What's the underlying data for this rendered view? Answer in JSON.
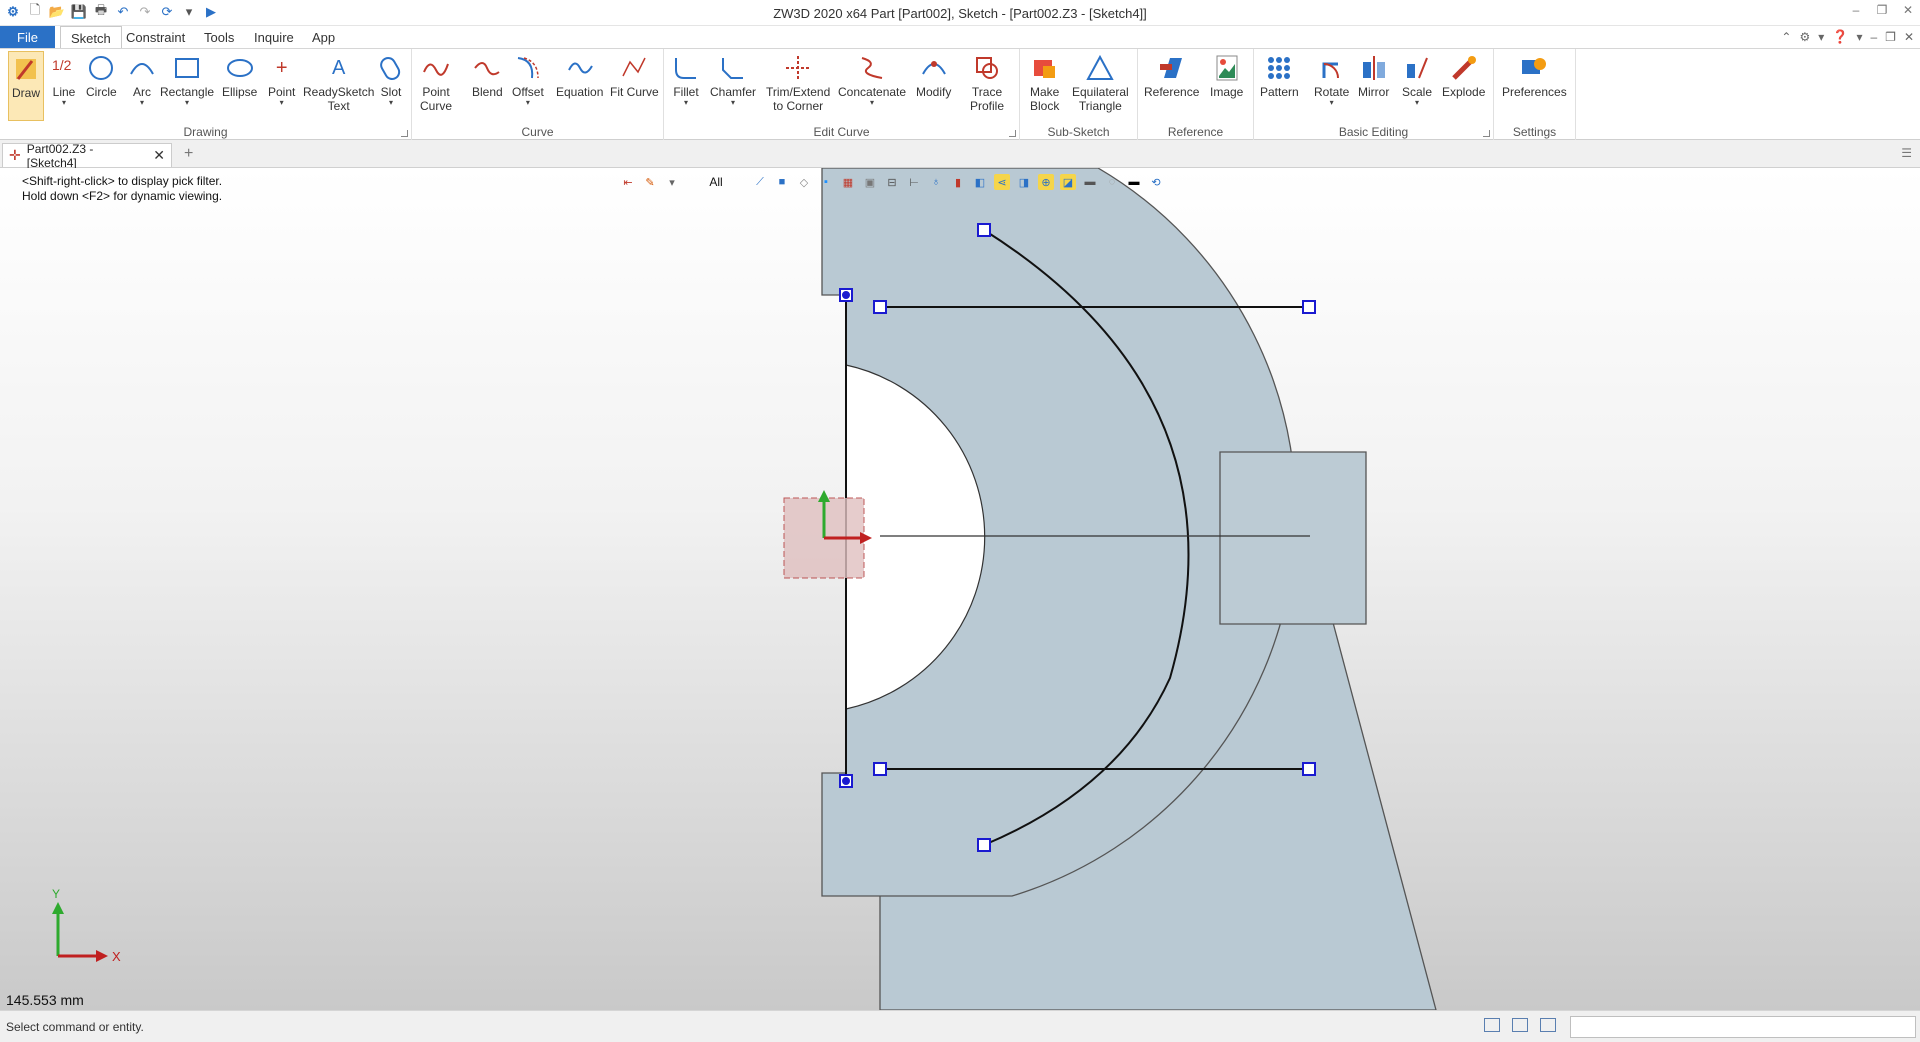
{
  "titlebar": {
    "title": "ZW3D 2020 x64        Part [Part002],  Sketch - [Part002.Z3 - [Sketch4]]"
  },
  "tabs": {
    "file": "File",
    "items": [
      "Sketch",
      "Constraint",
      "Tools",
      "Inquire",
      "App"
    ]
  },
  "ribbon": {
    "groups": {
      "drawing": "Drawing",
      "curve": "Curve",
      "edit_curve": "Edit Curve",
      "sub_sketch": "Sub-Sketch",
      "reference": "Reference",
      "basic_editing": "Basic Editing",
      "settings": "Settings"
    },
    "tools": {
      "draw": "Draw",
      "line": "Line",
      "circle": "Circle",
      "arc": "Arc",
      "rectangle": "Rectangle",
      "ellipse": "Ellipse",
      "point": "Point",
      "readysketch_text": "ReadySketch\nText",
      "slot": "Slot",
      "point_curve": "Point\nCurve",
      "blend": "Blend",
      "offset": "Offset",
      "equation": "Equation",
      "fit_curve": "Fit Curve",
      "fillet": "Fillet",
      "chamfer": "Chamfer",
      "trim_extend": "Trim/Extend\nto Corner",
      "concatenate": "Concatenate",
      "modify": "Modify",
      "trace_profile": "Trace\nProfile",
      "make_block": "Make\nBlock",
      "equilateral_triangle": "Equilateral\nTriangle",
      "reference": "Reference",
      "image": "Image",
      "pattern": "Pattern",
      "rotate": "Rotate",
      "mirror": "Mirror",
      "scale": "Scale",
      "explode": "Explode",
      "preferences": "Preferences"
    }
  },
  "document": {
    "tab_label": "Part002.Z3 - [Sketch4]"
  },
  "viewport": {
    "hint_line1": "<Shift-right-click> to display pick filter.",
    "hint_line2": "Hold down <F2> for dynamic viewing.",
    "filter": "All",
    "measurement": "145.553 mm",
    "axis_x": "X",
    "axis_y": "Y"
  },
  "status": {
    "text": "Select command or entity.",
    "command_placeholder": ""
  },
  "colors": {
    "accent": "#2b71c6",
    "part_fill": "#b9c9d3",
    "handle": "#1a1ad0",
    "active_tool": "#fce8b6"
  }
}
